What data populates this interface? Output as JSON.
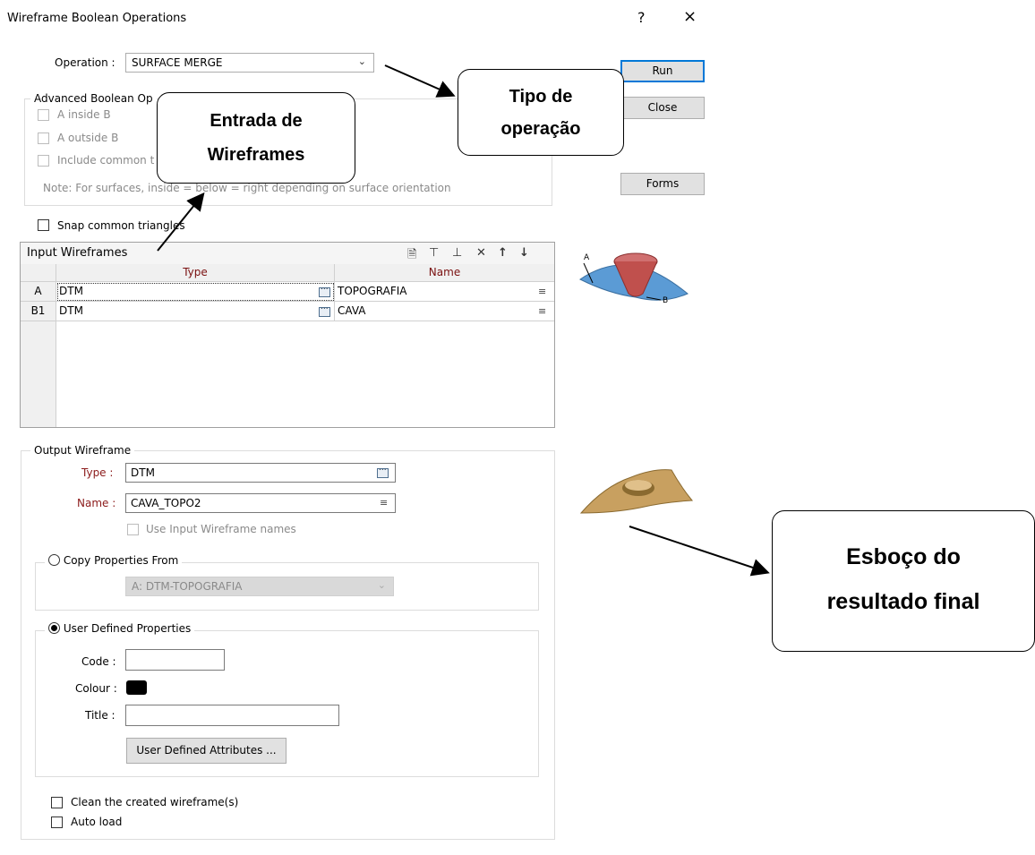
{
  "window": {
    "title": "Wireframe Boolean Operations",
    "help_icon": "?",
    "close_icon": "×"
  },
  "operation": {
    "label": "Operation :",
    "value": "SURFACE MERGE"
  },
  "buttons": {
    "run": "Run",
    "close": "Close",
    "forms": "Forms"
  },
  "advanced": {
    "legend": "Advanced Boolean Op",
    "a_inside_b": "A inside B",
    "a_outside_b": "A outside B",
    "include_common": "Include common t",
    "note": "Note: For surfaces, inside = below = right depending on surface orientation"
  },
  "snap_label": "Snap common triangles",
  "input_grid": {
    "title": "Input Wireframes",
    "toolbar_icons": [
      "new-page-icon",
      "insert-row-icon",
      "append-row-icon",
      "delete-icon",
      "move-up-icon",
      "move-down-icon"
    ],
    "columns": [
      "Type",
      "Name"
    ],
    "rows": [
      {
        "id": "A",
        "type": "DTM",
        "name": "TOPOGRAFIA"
      },
      {
        "id": "B1",
        "type": "DTM",
        "name": "CAVA"
      }
    ]
  },
  "diagram_labels": {
    "a": "A",
    "b": "B"
  },
  "output": {
    "legend": "Output Wireframe",
    "type_label": "Type :",
    "type_value": "DTM",
    "name_label": "Name :",
    "name_value": "CAVA_TOPO2",
    "use_input_names": "Use Input Wireframe names",
    "copy_from_label": "Copy Properties From",
    "copy_from_value": "A: DTM-TOPOGRAFIA",
    "user_defined_label": "User Defined Properties",
    "code_label": "Code :",
    "code_value": "",
    "colour_label": "Colour :",
    "colour_value": "#000000",
    "title_label": "Title :",
    "title_value": "",
    "attributes_button": "User Defined Attributes ...",
    "clean_label": "Clean the created wireframe(s)",
    "auto_load_label": "Auto load"
  },
  "callouts": {
    "tipo_line1": "Tipo de",
    "tipo_line2": "operação",
    "entrada_line1": "Entrada de",
    "entrada_line2": "Wireframes",
    "esboco_line1": "Esboço do",
    "esboco_line2": "resultado final"
  },
  "colors": {
    "accent": "#0078d7",
    "surface_blue": "#5b9bd5",
    "pit_red": "#c0504d",
    "result_tan": "#c8a060"
  }
}
